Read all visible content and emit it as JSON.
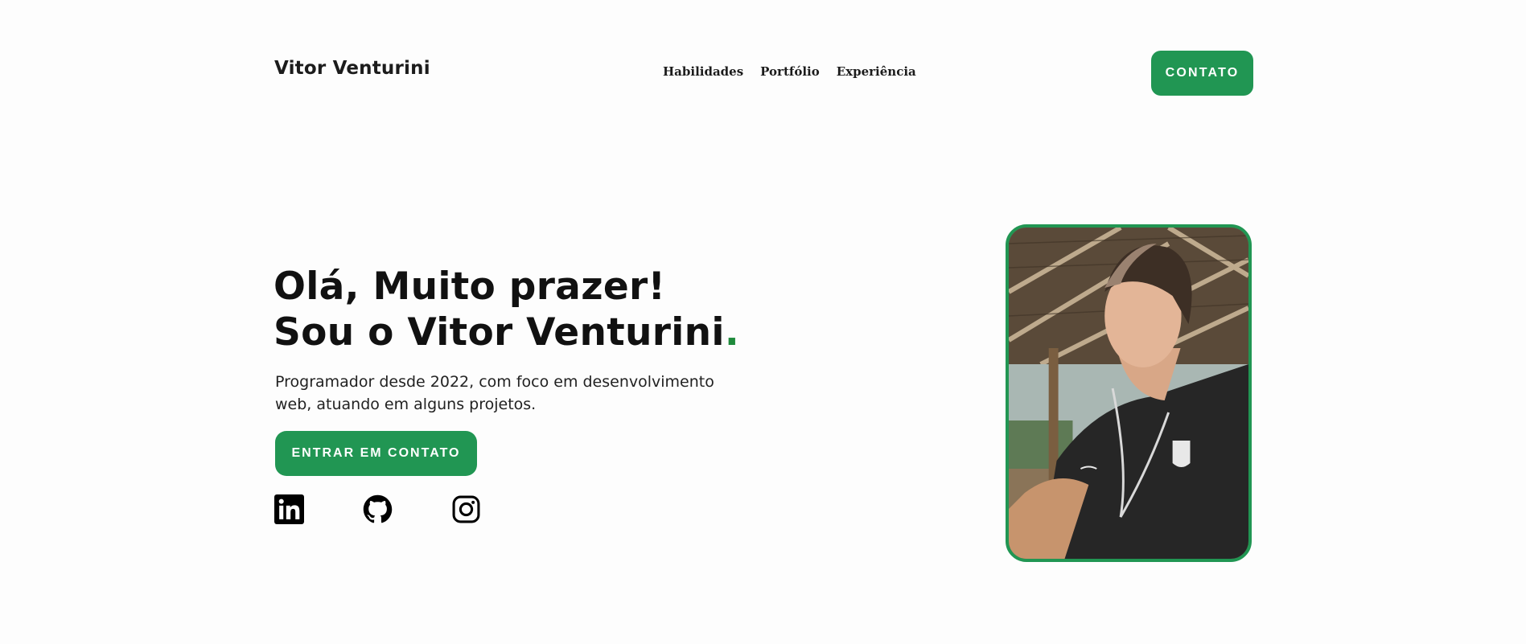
{
  "header": {
    "brand": "Vitor Venturini",
    "nav": [
      "Habilidades",
      "Portfólio",
      "Experiência"
    ],
    "contact_button": "CONTATO"
  },
  "hero": {
    "title_line1": "Olá, Muito prazer!",
    "title_line2": "Sou o Vitor Venturini",
    "title_dot": ".",
    "description": "Programador desde 2022, com foco em desenvolvimento web, atuando em alguns projetos.",
    "cta_button": "ENTRAR EM CONTATO"
  },
  "socials": [
    {
      "name": "linkedin",
      "icon": "linkedin-icon"
    },
    {
      "name": "github",
      "icon": "github-icon"
    },
    {
      "name": "instagram",
      "icon": "instagram-icon"
    }
  ],
  "photo": {
    "alt": "Vitor Venturini"
  },
  "colors": {
    "accent": "#219653",
    "dot": "#1f8a3c",
    "text": "#111111",
    "background": "#fdfdfd"
  }
}
